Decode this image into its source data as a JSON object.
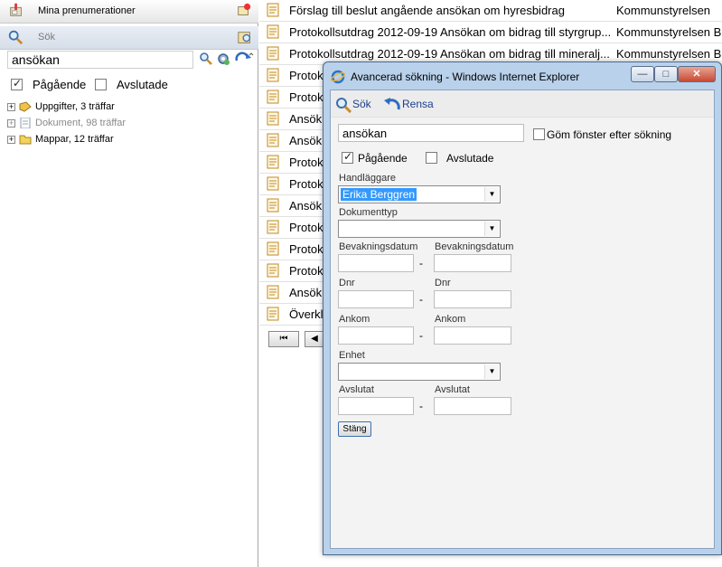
{
  "left": {
    "subscriptions_label": "Mina prenumerationer",
    "search_label": "Sök",
    "search_value": "ansökan",
    "ongoing_label": "Pågående",
    "ongoing_checked": true,
    "closed_label": "Avslutade",
    "closed_checked": false,
    "tree": [
      {
        "label": "Uppgifter, 3 träffar",
        "icon": "task-icon"
      },
      {
        "label": "Dokument, 98 träffar",
        "icon": "document-icon"
      },
      {
        "label": "Mappar, 12 träffar",
        "icon": "folder-icon"
      }
    ]
  },
  "list": {
    "rows": [
      {
        "title": "Förslag till beslut angående ansökan om hyresbidrag",
        "unit": "Kommunstyrelsen"
      },
      {
        "title": "Protokollsutdrag 2012-09-19 Ansökan om bidrag till styrgrup...",
        "unit": "Kommunstyrelsen Bo"
      },
      {
        "title": "Protokollsutdrag 2012-09-19 Ansökan om bidrag till mineralj...",
        "unit": "Kommunstyrelsen Bo"
      },
      {
        "title": "Protok",
        "unit": ""
      },
      {
        "title": "Protok",
        "unit": ""
      },
      {
        "title": "Ansök",
        "unit": ""
      },
      {
        "title": "Ansök",
        "unit": ""
      },
      {
        "title": "Protok",
        "unit": ""
      },
      {
        "title": "Protok",
        "unit": ""
      },
      {
        "title": "Ansök",
        "unit": ""
      },
      {
        "title": "Protok",
        "unit": ""
      },
      {
        "title": "Protok",
        "unit": ""
      },
      {
        "title": "Protok",
        "unit": ""
      },
      {
        "title": "Ansök",
        "unit": ""
      },
      {
        "title": "Överkl",
        "unit": ""
      }
    ],
    "pager_first": "⏮",
    "pager_prev": "◀"
  },
  "dialog": {
    "title": "Avancerad sökning - Windows Internet Explorer",
    "win_minimize": "—",
    "win_maximize": "□",
    "win_close": "✕",
    "search_btn": "Sök",
    "clear_btn": "Rensa",
    "query": "ansökan",
    "hide_window_label": "Göm fönster efter sökning",
    "hide_window_checked": false,
    "ongoing_label": "Pågående",
    "ongoing_checked": true,
    "closed_label": "Avslutade",
    "closed_checked": false,
    "handler_label": "Handläggare",
    "handler_value": "Erika Berggren",
    "doctype_label": "Dokumenttyp",
    "doctype_value": "",
    "watch_from_label": "Bevakningsdatum",
    "watch_to_label": "Bevakningsdatum",
    "dnr_from_label": "Dnr",
    "dnr_to_label": "Dnr",
    "arrived_from_label": "Ankom",
    "arrived_to_label": "Ankom",
    "unit_label": "Enhet",
    "unit_value": "",
    "closed_from_label": "Avslutat",
    "closed_to_label": "Avslutat",
    "range_dash": "-",
    "close_btn": "Stäng"
  },
  "colors": {
    "accent": "#3399ff",
    "link": "#1b3f8f",
    "title_bar": "#b9d1ea"
  }
}
